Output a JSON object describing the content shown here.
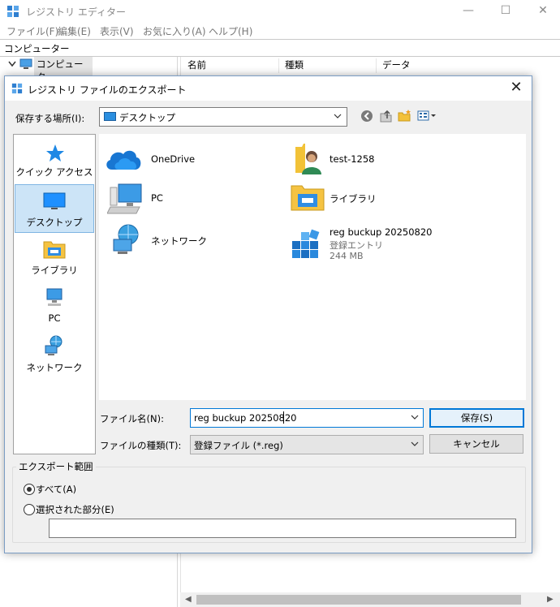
{
  "main_window": {
    "title": "レジストリ エディター",
    "menu": [
      "ファイル(F)",
      "編集(E)",
      "表示(V)",
      "お気に入り(A)",
      "ヘルプ(H)"
    ],
    "address": "コンピューター",
    "tree_root": "コンピューター",
    "columns": [
      "名前",
      "種類",
      "データ"
    ]
  },
  "dialog": {
    "title": "レジストリ ファイルのエクスポート",
    "save_in_label": "保存する場所(I):",
    "save_in_value": "デスクトップ",
    "places": [
      {
        "label": "クイック アクセス",
        "icon": "quick-access-star-icon"
      },
      {
        "label": "デスクトップ",
        "icon": "desktop-icon",
        "selected": true
      },
      {
        "label": "ライブラリ",
        "icon": "library-icon"
      },
      {
        "label": "PC",
        "icon": "pc-icon"
      },
      {
        "label": "ネットワーク",
        "icon": "network-icon"
      }
    ],
    "files": [
      {
        "name": "OneDrive",
        "icon": "onedrive-cloud-icon"
      },
      {
        "name": "test-1258",
        "icon": "user-folder-icon"
      },
      {
        "name": "PC",
        "icon": "pc-icon"
      },
      {
        "name": "ライブラリ",
        "icon": "library-icon"
      },
      {
        "name": "ネットワーク",
        "icon": "network-icon"
      },
      {
        "name": "reg buckup 20250820",
        "type": "登録エントリ",
        "size": "244 MB",
        "icon": "registry-file-icon"
      }
    ],
    "filename_label": "ファイル名(N):",
    "filename_value": "reg buckup 20250820",
    "filetype_label": "ファイルの種類(T):",
    "filetype_value": "登録ファイル (*.reg)",
    "save_button": "保存(S)",
    "cancel_button": "キャンセル",
    "export_range_label": "エクスポート範囲",
    "export_all": "すべて(A)",
    "export_selected": "選択された部分(E)",
    "export_range_value": ""
  }
}
